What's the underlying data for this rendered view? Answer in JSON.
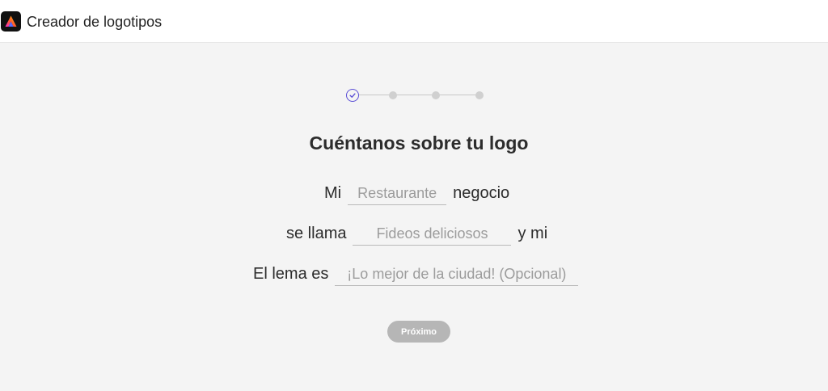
{
  "header": {
    "app_title": "Creador de logotipos",
    "logo_icon": "adobe-express-logo"
  },
  "stepper": {
    "total_steps": 4,
    "current_step": 1,
    "accent_color": "#5b4fd6"
  },
  "form": {
    "heading": "Cuéntanos sobre tu logo",
    "row1": {
      "prefix": "Mi",
      "placeholder": "Restaurante",
      "value": "",
      "suffix": "negocio"
    },
    "row2": {
      "prefix": "se llama",
      "placeholder": "Fideos deliciosos",
      "value": "",
      "suffix": "y mi"
    },
    "row3": {
      "prefix": "El lema es",
      "placeholder": "¡Lo mejor de la ciudad! (Opcional)",
      "value": ""
    }
  },
  "next_button": {
    "label": "Próximo",
    "enabled": false
  }
}
